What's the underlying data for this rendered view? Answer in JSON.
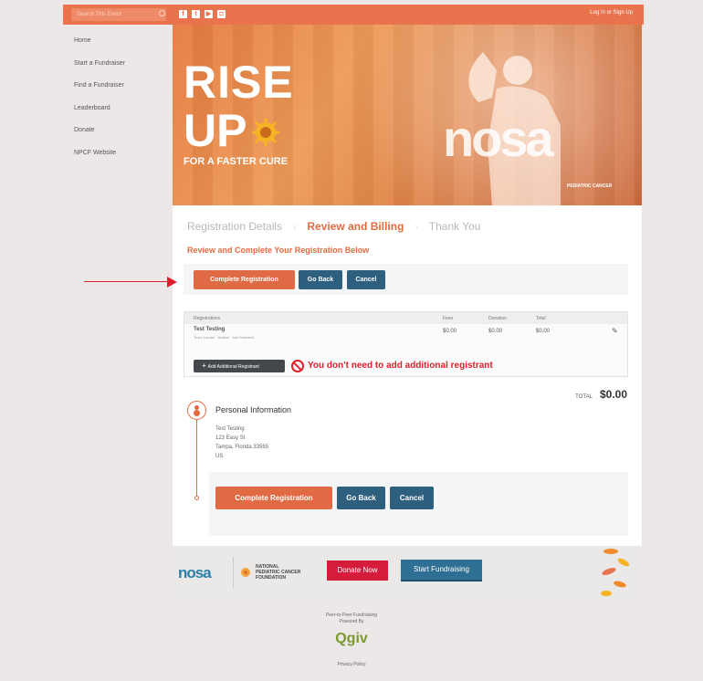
{
  "header": {
    "search_placeholder": "Search This Event",
    "social_icons": [
      "facebook-icon",
      "twitter-icon",
      "youtube-icon",
      "instagram-icon"
    ],
    "login_label": "Log In or Sign Up"
  },
  "sidebar": {
    "items": [
      {
        "label": "Home"
      },
      {
        "label": "Start a Fundraiser"
      },
      {
        "label": "Find a Fundraiser"
      },
      {
        "label": "Leaderboard"
      },
      {
        "label": "Donate"
      },
      {
        "label": "NPCF Website"
      }
    ]
  },
  "hero": {
    "line1": "RISE",
    "line2": "UP",
    "tagline": "FOR A FASTER CURE",
    "overlay_text": "nosa",
    "sponsor_text": "PEDIATRIC CANCER"
  },
  "steps": {
    "step1": "Registration Details",
    "step2": "Review and Billing",
    "step3": "Thank You"
  },
  "review": {
    "subtitle": "Review and Complete Your Registration Below",
    "complete_label": "Complete Registration",
    "back_label": "Go Back",
    "cancel_label": "Cancel"
  },
  "table": {
    "headers": {
      "registrations": "Registrations",
      "fees": "Fees",
      "donation": "Donation",
      "total": "Total"
    },
    "rows": [
      {
        "name": "Test Testing",
        "detail": "Team Leader · Walker · Not Selected",
        "fees": "$0.00",
        "donation": "$0.00",
        "total": "$0.00"
      }
    ],
    "add_label": "Add Additional Registrant"
  },
  "annotation": {
    "warning_text": "You don't need to add additional registrant"
  },
  "summary": {
    "total_label": "TOTAL",
    "total_value": "$0.00"
  },
  "personal": {
    "title": "Personal Information",
    "name": "Test Testing",
    "street": "123 Easy St",
    "city": "Tampa, Florida 33565",
    "country": "US"
  },
  "footer": {
    "nosa_logo": "nosa",
    "npcf_line1": "NATIONAL",
    "npcf_line2": "PEDIATRIC CANCER",
    "npcf_line3": "FOUNDATION",
    "donate_label": "Donate Now",
    "fundraising_label": "Start Fundraising",
    "powered_line1": "Peer-to-Peer Fundraising",
    "powered_line2": "Powered By",
    "qgiv_logo": "Qgiv",
    "privacy_label": "Privacy Policy"
  },
  "colors": {
    "brand_orange": "#e26b3f",
    "button_blue": "#2f5f7e",
    "alert_red": "#e01f2c",
    "donate_red": "#d51d3b"
  }
}
